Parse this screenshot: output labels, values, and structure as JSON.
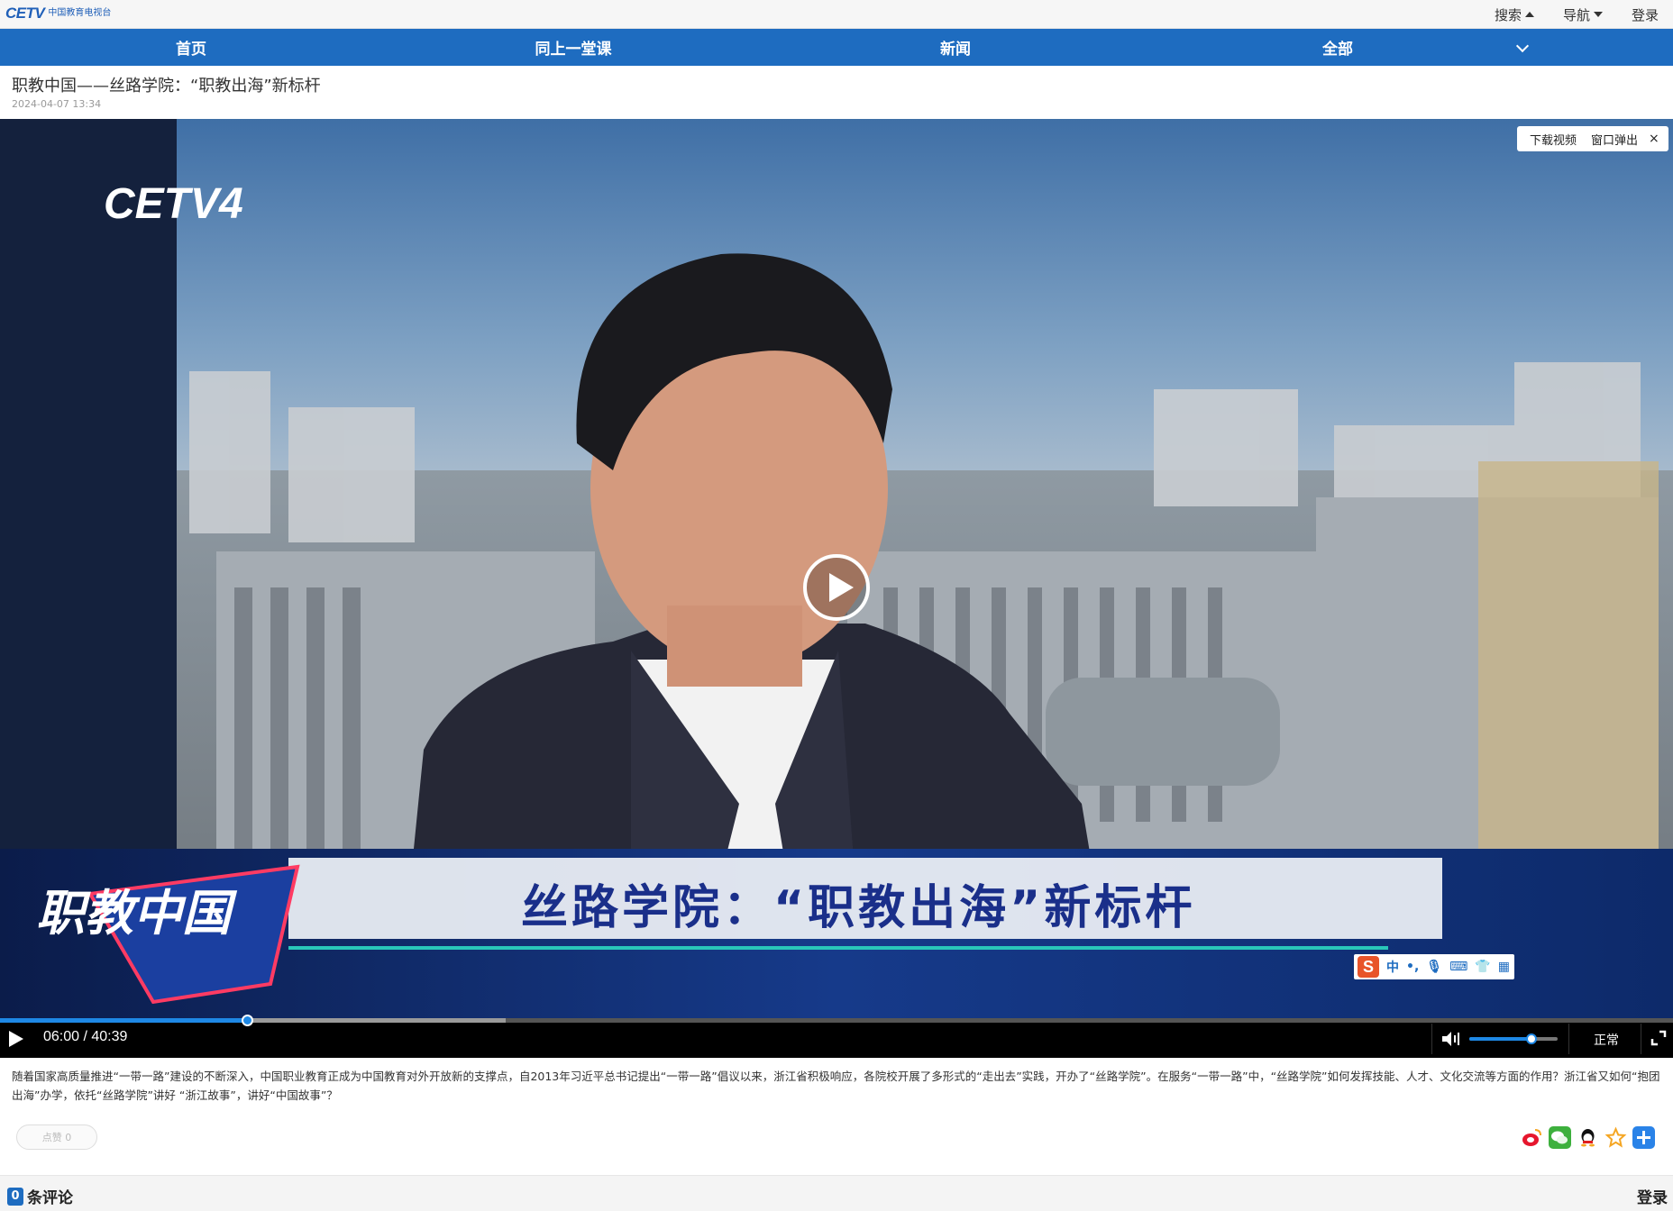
{
  "logo": {
    "mark": "CETV",
    "subtitle": "中国教育电视台"
  },
  "topbar": {
    "search_label": "搜索",
    "nav_label": "导航",
    "login_label": "登录"
  },
  "navbar": {
    "items": [
      "首页",
      "同上一堂课",
      "新闻",
      "全部"
    ]
  },
  "article": {
    "title": "职教中国——丝路学院：“职教出海”新标杆",
    "date": "2024-04-07 13:34"
  },
  "video": {
    "channel_logo": "CETV4",
    "program_logo": "职教中国",
    "banner": "丝路学院：“职教出海”新标杆",
    "tools": {
      "download": "下载视频",
      "popout": "窗口弹出",
      "close": "×"
    },
    "time_display": "06:00 / 40:39",
    "progress_fraction": 0.1476,
    "buffered_fraction": 0.302,
    "volume_fraction": 0.7,
    "speed_label": "正常",
    "ime": {
      "logo": "S",
      "mode": "中"
    }
  },
  "description": "随着国家高质量推进“一带一路”建设的不断深入，中国职业教育正成为中国教育对外开放新的支撑点，自2013年习近平总书记提出“一带一路”倡议以来，浙江省积极响应，各院校开展了多形式的“走出去”实践，开办了“丝路学院”。在服务“一带一路”中，“丝路学院”如何发挥技能、人才、文化交流等方面的作用？浙江省又如何“抱团出海”办学，依托“丝路学院”讲好 “浙江故事”，讲好“中国故事”？",
  "like_label": "点赞 0",
  "share_icons": [
    "weibo-icon",
    "wechat-icon",
    "qq-icon",
    "favorite-icon",
    "more-share-icon"
  ],
  "comments": {
    "count": "0",
    "label": "条评论",
    "login": "登录"
  },
  "colors": {
    "brand_blue": "#1e6cc0",
    "progress_blue": "#1e88e5"
  }
}
